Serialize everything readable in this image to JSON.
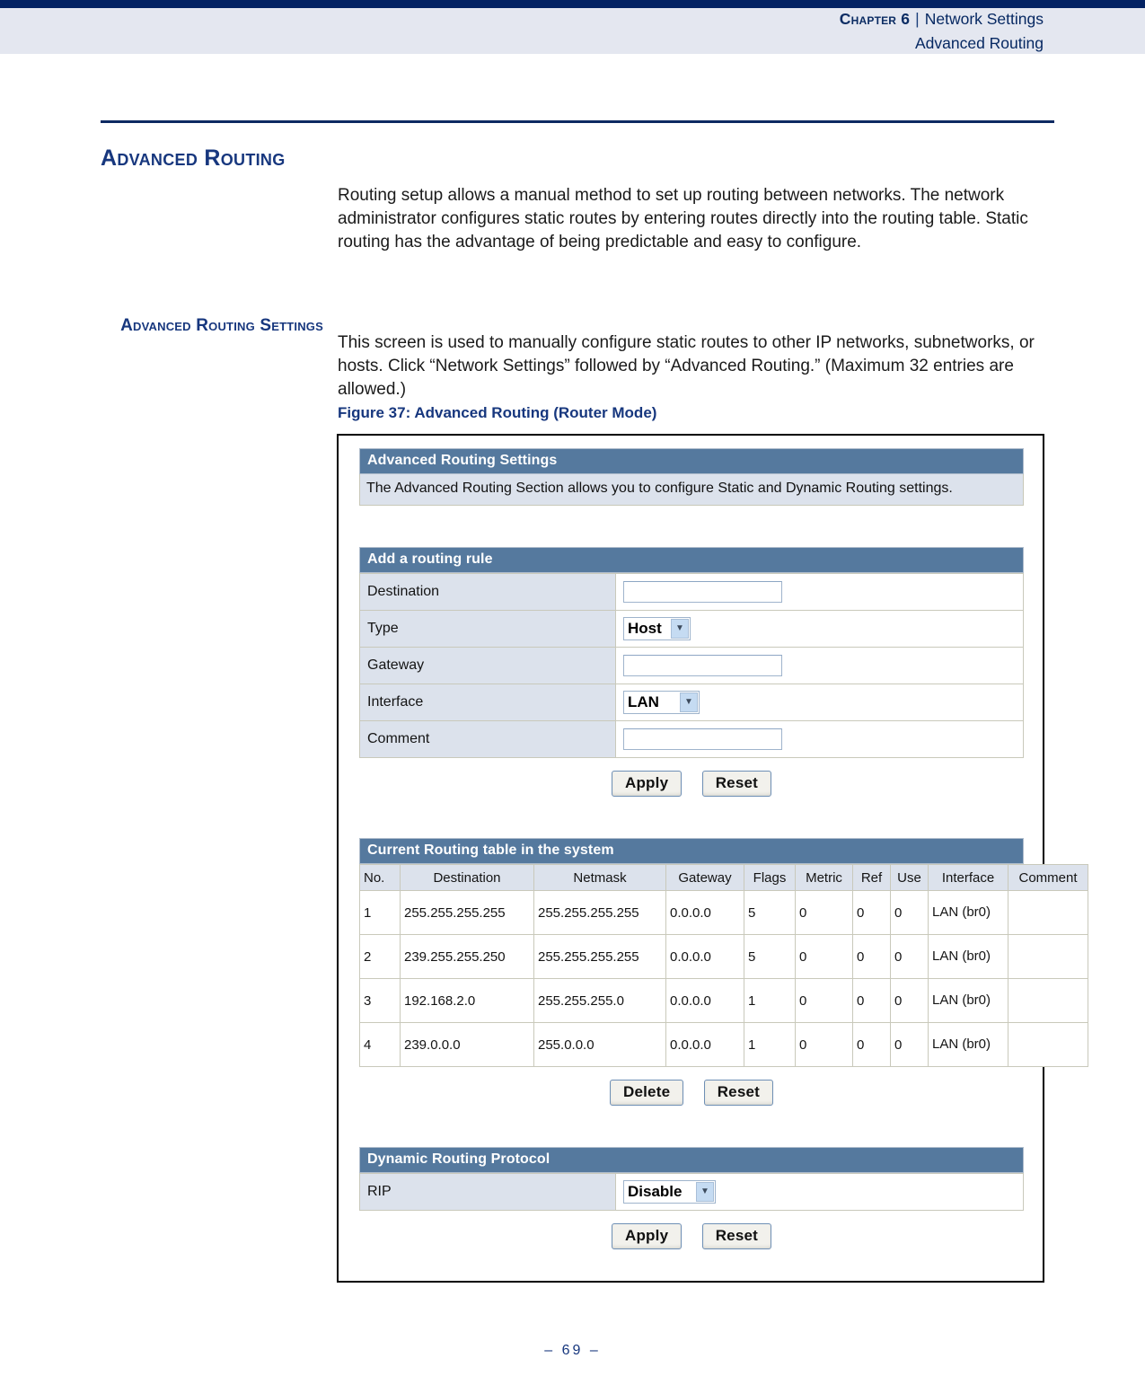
{
  "header": {
    "chapter": "Chapter 6",
    "separator": "|",
    "section": "Network Settings",
    "subsection": "Advanced Routing"
  },
  "page": {
    "heading": "Advanced Routing",
    "intro_paragraph": "Routing setup allows a manual method to set up routing between networks. The network administrator configures static routes by entering routes directly into the routing table. Static routing has the advantage of being predictable and easy to configure.",
    "side_heading": "Advanced Routing Settings",
    "body_paragraph": "This screen is used to manually configure static routes to other IP networks, subnetworks, or hosts. Click “Network Settings” followed by “Advanced Routing.” (Maximum 32 entries are allowed.)",
    "figure_caption": "Figure 37:  Advanced Routing (Router Mode)",
    "folio": "–  69  –"
  },
  "screenshot": {
    "settings_panel": {
      "title": "Advanced Routing Settings",
      "description": "The Advanced Routing Section allows you to configure Static and Dynamic Routing settings."
    },
    "add_rule_panel": {
      "title": "Add a routing rule",
      "fields": [
        {
          "label": "Destination",
          "control": "text",
          "value": ""
        },
        {
          "label": "Type",
          "control": "select",
          "value": "Host"
        },
        {
          "label": "Gateway",
          "control": "text",
          "value": ""
        },
        {
          "label": "Interface",
          "control": "select",
          "value": "LAN"
        },
        {
          "label": "Comment",
          "control": "text",
          "value": ""
        }
      ],
      "apply_label": "Apply",
      "reset_label": "Reset"
    },
    "routing_table_panel": {
      "title": "Current Routing table in the system",
      "columns": [
        "No.",
        "Destination",
        "Netmask",
        "Gateway",
        "Flags",
        "Metric",
        "Ref",
        "Use",
        "Interface",
        "Comment"
      ],
      "rows": [
        {
          "no": "1",
          "destination": "255.255.255.255",
          "netmask": "255.255.255.255",
          "gateway": "0.0.0.0",
          "flags": "5",
          "metric": "0",
          "ref": "0",
          "use": "0",
          "interface": "LAN (br0)",
          "comment": ""
        },
        {
          "no": "2",
          "destination": "239.255.255.250",
          "netmask": "255.255.255.255",
          "gateway": "0.0.0.0",
          "flags": "5",
          "metric": "0",
          "ref": "0",
          "use": "0",
          "interface": "LAN (br0)",
          "comment": ""
        },
        {
          "no": "3",
          "destination": "192.168.2.0",
          "netmask": "255.255.255.0",
          "gateway": "0.0.0.0",
          "flags": "1",
          "metric": "0",
          "ref": "0",
          "use": "0",
          "interface": "LAN (br0)",
          "comment": ""
        },
        {
          "no": "4",
          "destination": "239.0.0.0",
          "netmask": "255.0.0.0",
          "gateway": "0.0.0.0",
          "flags": "1",
          "metric": "0",
          "ref": "0",
          "use": "0",
          "interface": "LAN (br0)",
          "comment": ""
        }
      ],
      "delete_label": "Delete",
      "reset_label": "Reset"
    },
    "dynamic_panel": {
      "title": "Dynamic Routing Protocol",
      "rip_label": "RIP",
      "rip_value": "Disable",
      "apply_label": "Apply",
      "reset_label": "Reset"
    },
    "colors": {
      "panel_header": "#55799e",
      "label_cell": "#dce2ec",
      "navy_rule": "#032263",
      "header_band": "#e4e7f0",
      "heading_blue": "#17377e"
    }
  }
}
